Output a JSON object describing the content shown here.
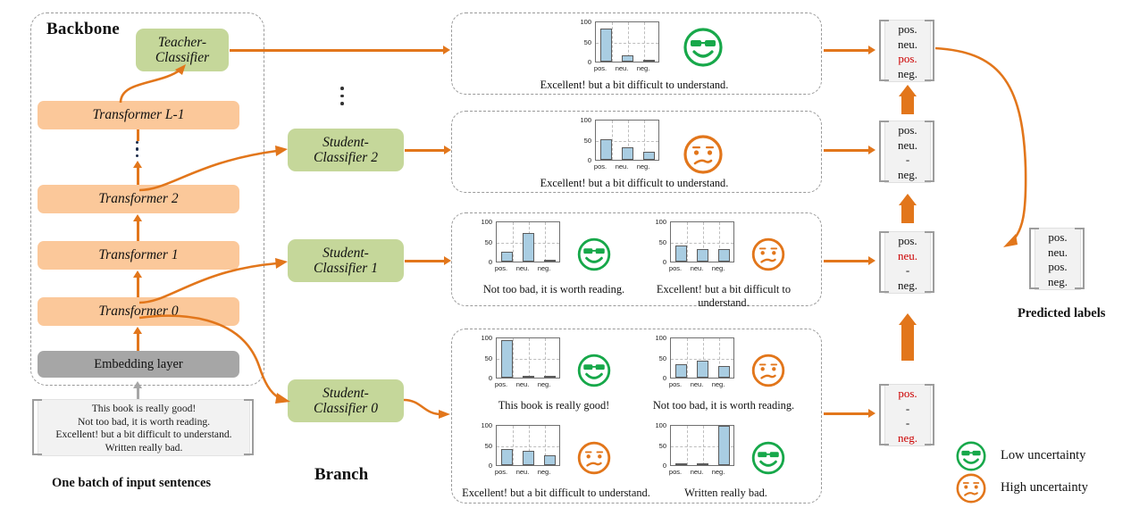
{
  "titles": {
    "backbone": "Backbone",
    "branch": "Branch",
    "input_caption": "One batch of input sentences",
    "predicted_caption": "Predicted labels"
  },
  "backbone": {
    "teacher_classifier": "Teacher-\nClassifier",
    "teacher_line1": "Teacher-",
    "teacher_line2": "Classifier",
    "layers": [
      {
        "label": "Transformer L-1"
      },
      {
        "label": "Transformer 2"
      },
      {
        "label": "Transformer 1"
      },
      {
        "label": "Transformer 0"
      }
    ],
    "embedding": "Embedding layer"
  },
  "students": [
    {
      "line1": "Student-",
      "line2": "Classifier 2"
    },
    {
      "line1": "Student-",
      "line2": "Classifier 1"
    },
    {
      "line1": "Student-",
      "line2": "Classifier 0"
    }
  ],
  "input_sentences": [
    "This book is really good!",
    "Not too bad, it is worth reading.",
    "Excellent!  but a bit difficult to understand.",
    "Written really bad."
  ],
  "chart_data": [
    {
      "id": "teacher-chart",
      "type": "bar",
      "categories": [
        "pos.",
        "neu.",
        "neg."
      ],
      "values": [
        80,
        15,
        5
      ],
      "ylim": [
        0,
        100
      ],
      "yticks": [
        0,
        50,
        100
      ],
      "title": "",
      "xlabel": "",
      "ylabel": "",
      "grid": true,
      "sentence": "Excellent!  but a bit difficult to understand.",
      "uncertainty": "low"
    },
    {
      "id": "student2-chart",
      "type": "bar",
      "categories": [
        "pos.",
        "neu.",
        "neg."
      ],
      "values": [
        50,
        30,
        20
      ],
      "ylim": [
        0,
        100
      ],
      "yticks": [
        0,
        50,
        100
      ],
      "grid": true,
      "sentence": "Excellent!  but a bit difficult to understand.",
      "uncertainty": "high"
    },
    {
      "id": "student1-chart-a",
      "type": "bar",
      "categories": [
        "pos.",
        "neu.",
        "neg."
      ],
      "values": [
        25,
        70,
        5
      ],
      "ylim": [
        0,
        100
      ],
      "yticks": [
        0,
        50,
        100
      ],
      "grid": true,
      "sentence": "Not too bad, it is worth reading.",
      "uncertainty": "low"
    },
    {
      "id": "student1-chart-b",
      "type": "bar",
      "categories": [
        "pos.",
        "neu.",
        "neg."
      ],
      "values": [
        40,
        30,
        30
      ],
      "ylim": [
        0,
        100
      ],
      "yticks": [
        0,
        50,
        100
      ],
      "grid": true,
      "sentence": "Excellent!  but a bit difficult to understand.",
      "uncertainty": "high"
    },
    {
      "id": "student0-chart-a",
      "type": "bar",
      "categories": [
        "pos.",
        "neu.",
        "neg."
      ],
      "values": [
        92,
        5,
        4
      ],
      "ylim": [
        0,
        100
      ],
      "yticks": [
        0,
        50,
        100
      ],
      "grid": true,
      "sentence": "This book is really good!",
      "uncertainty": "low"
    },
    {
      "id": "student0-chart-b",
      "type": "bar",
      "categories": [
        "pos.",
        "neu.",
        "neg."
      ],
      "values": [
        32,
        42,
        28
      ],
      "ylim": [
        0,
        100
      ],
      "yticks": [
        0,
        50,
        100
      ],
      "grid": true,
      "sentence": "Not too bad, it is worth reading.",
      "uncertainty": "high"
    },
    {
      "id": "student0-chart-c",
      "type": "bar",
      "categories": [
        "pos.",
        "neu.",
        "neg."
      ],
      "values": [
        40,
        35,
        25
      ],
      "ylim": [
        0,
        100
      ],
      "yticks": [
        0,
        50,
        100
      ],
      "grid": true,
      "sentence": "Excellent!  but a bit difficult to understand.",
      "uncertainty": "high"
    },
    {
      "id": "student0-chart-d",
      "type": "bar",
      "categories": [
        "pos.",
        "neu.",
        "neg."
      ],
      "values": [
        5,
        2,
        95
      ],
      "ylim": [
        0,
        100
      ],
      "yticks": [
        0,
        50,
        100
      ],
      "grid": true,
      "sentence": "Written really bad.",
      "uncertainty": "low"
    }
  ],
  "label_boxes": [
    {
      "id": "teacher-labels",
      "items": [
        {
          "text": "pos.",
          "red": false
        },
        {
          "text": "neu.",
          "red": false
        },
        {
          "text": "pos.",
          "red": true
        },
        {
          "text": "neg.",
          "red": false
        }
      ]
    },
    {
      "id": "student2-labels",
      "items": [
        {
          "text": "pos.",
          "red": false
        },
        {
          "text": "neu.",
          "red": false
        },
        {
          "text": "-",
          "red": false
        },
        {
          "text": "neg.",
          "red": false
        }
      ]
    },
    {
      "id": "student1-labels",
      "items": [
        {
          "text": "pos.",
          "red": false
        },
        {
          "text": "neu.",
          "red": true
        },
        {
          "text": "-",
          "red": false
        },
        {
          "text": "neg.",
          "red": false
        }
      ]
    },
    {
      "id": "student0-labels",
      "items": [
        {
          "text": "pos.",
          "red": true
        },
        {
          "text": "-",
          "red": false
        },
        {
          "text": "-",
          "red": false
        },
        {
          "text": "neg.",
          "red": true
        }
      ]
    }
  ],
  "predicted_labels": [
    "pos.",
    "neu.",
    "pos.",
    "neg."
  ],
  "legend": [
    {
      "icon": "cool-face-icon",
      "label": "Low uncertainty",
      "color": "#17a84a"
    },
    {
      "icon": "confused-face-icon",
      "label": "High uncertainty",
      "color": "#e2761b"
    }
  ],
  "colors": {
    "transformer": "#fbc89a",
    "classifier": "#c5d79a",
    "embedding": "#a6a6a6",
    "arrow": "#e2761b",
    "bar": "#a9cde2",
    "low_uncertainty": "#17a84a",
    "high_uncertainty": "#e2761b",
    "red_label": "#cc0000"
  }
}
